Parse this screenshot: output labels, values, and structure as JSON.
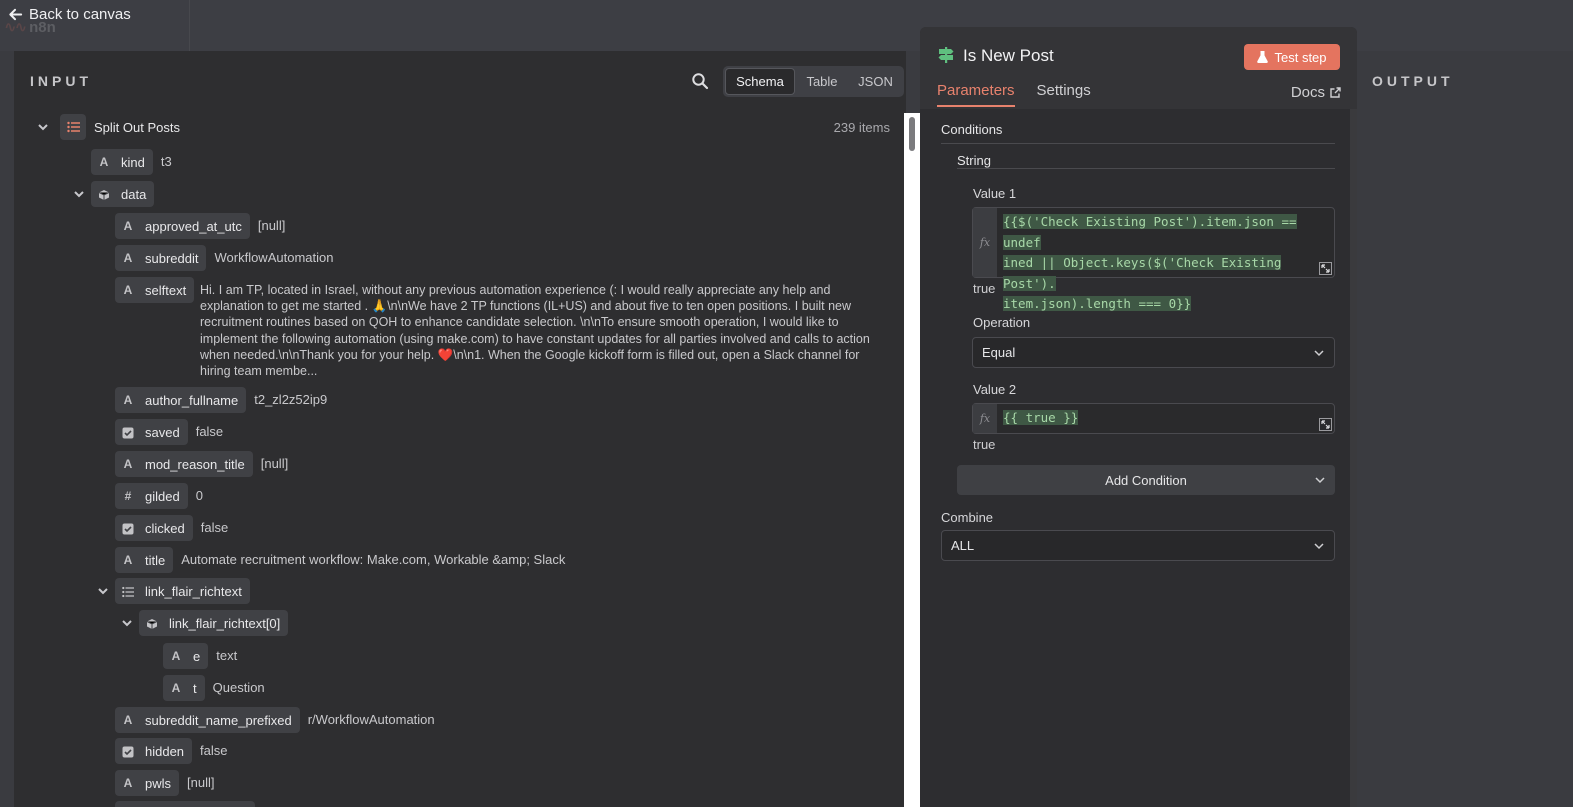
{
  "header": {
    "back_label": "Back to canvas",
    "logo_text": "n8n"
  },
  "input": {
    "title": "INPUT",
    "views": [
      "Schema",
      "Table",
      "JSON"
    ],
    "root": {
      "name": "Split Out Posts",
      "count": "239 items"
    },
    "fields": {
      "kind": {
        "key": "kind",
        "value": "t3",
        "type": "A"
      },
      "data": {
        "key": "data"
      },
      "approved_at_utc": {
        "key": "approved_at_utc",
        "value": "[null]",
        "type": "A"
      },
      "subreddit": {
        "key": "subreddit",
        "value": "WorkflowAutomation",
        "type": "A"
      },
      "selftext": {
        "key": "selftext",
        "type": "A",
        "value": "Hi. I am TP, located in Israel, without any previous automation experience (: I would really appreciate any help and explanation to get me started . 🙏\\n\\nWe have 2 TP functions (IL+US) and about five to ten open positions. I built new recruitment routines based on QOH to enhance candidate selection. \\n\\nTo ensure smooth operation, I would like to implement the following automation (using make.com) to have constant updates for all parties involved and calls to action when needed.\\n\\nThank you for your help. ❤️\\n\\n1. When the Google kickoff form is filled out, open a Slack channel for hiring team membe..."
      },
      "author_fullname": {
        "key": "author_fullname",
        "value": "t2_zl2z52ip9",
        "type": "A"
      },
      "saved": {
        "key": "saved",
        "value": "false"
      },
      "mod_reason_title": {
        "key": "mod_reason_title",
        "value": "[null]",
        "type": "A"
      },
      "gilded": {
        "key": "gilded",
        "value": "0",
        "type": "#"
      },
      "clicked": {
        "key": "clicked",
        "value": "false"
      },
      "title": {
        "key": "title",
        "value": "Automate recruitment workflow: Make.com, Workable &amp; Slack",
        "type": "A"
      },
      "link_flair_richtext": {
        "key": "link_flair_richtext"
      },
      "link_flair_richtext_0": {
        "key": "link_flair_richtext[0]"
      },
      "e": {
        "key": "e",
        "value": "text",
        "type": "A"
      },
      "t": {
        "key": "t",
        "value": "Question",
        "type": "A"
      },
      "subreddit_name_prefixed": {
        "key": "subreddit_name_prefixed",
        "value": "r/WorkflowAutomation",
        "type": "A"
      },
      "hidden": {
        "key": "hidden",
        "value": "false"
      },
      "pwls": {
        "key": "pwls",
        "value": "[null]",
        "type": "A"
      }
    }
  },
  "node": {
    "title": "Is New Post",
    "test_label": "Test step",
    "tabs": [
      "Parameters",
      "Settings"
    ],
    "docs_label": "Docs",
    "conditions_label": "Conditions",
    "string_label": "String",
    "value1_label": "Value 1",
    "value1_code": [
      "{{$('Check Existing Post').item.json == undef",
      "ined || Object.keys($('Check Existing Post').",
      "item.json).length === 0}}"
    ],
    "value1_result": "true",
    "operation_label": "Operation",
    "operation_value": "Equal",
    "value2_label": "Value 2",
    "value2_code": "{{ true }}",
    "value2_result": "true",
    "add_condition_label": "Add Condition",
    "combine_label": "Combine",
    "combine_value": "ALL",
    "fx_label": "fx"
  },
  "output": {
    "title": "OUTPUT"
  },
  "colors": {
    "accent": "#e8826d",
    "test_button": "#e4745f",
    "node_icon": "#5fbf7f",
    "code": "#a8d8a8"
  }
}
